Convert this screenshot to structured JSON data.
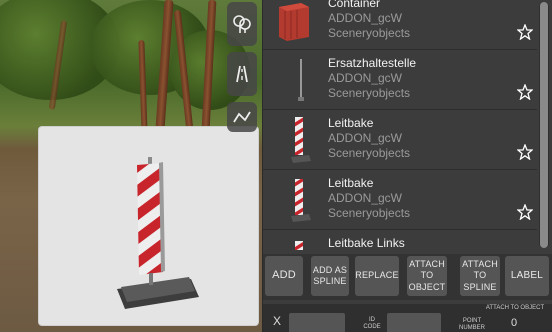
{
  "items": [
    {
      "name": "Container",
      "addon": "ADDON_gcW",
      "category": "Sceneryobjects"
    },
    {
      "name": "Ersatzhaltestelle",
      "addon": "ADDON_gcW",
      "category": "Sceneryobjects"
    },
    {
      "name": "Leitbake",
      "addon": "ADDON_gcW",
      "category": "Sceneryobjects"
    },
    {
      "name": "Leitbake",
      "addon": "ADDON_gcW",
      "category": "Sceneryobjects"
    },
    {
      "name": "Leitbake Links",
      "addon": "",
      "category": ""
    }
  ],
  "buttons": {
    "add": "Add",
    "add_as_spline": "Add as spline",
    "replace": "Replace",
    "attach_to_object": "Attach to object",
    "attach_to_spline": "Attach to spline",
    "label": "Label"
  },
  "bottom": {
    "x_label": "X",
    "id_label": "ID code",
    "point_label": "Point number",
    "attach_label": "Attach to object",
    "attach_value": "0"
  },
  "icons": {
    "tool1": "tree-icon",
    "tool2": "road-icon",
    "tool3": "spline-icon",
    "favorite": "star-icon"
  },
  "colors": {
    "panel": "#3c3c3c",
    "button": "#555555",
    "text": "#f2f2f2",
    "muted": "#9a9a9a",
    "beacon_red": "#c8242b"
  }
}
